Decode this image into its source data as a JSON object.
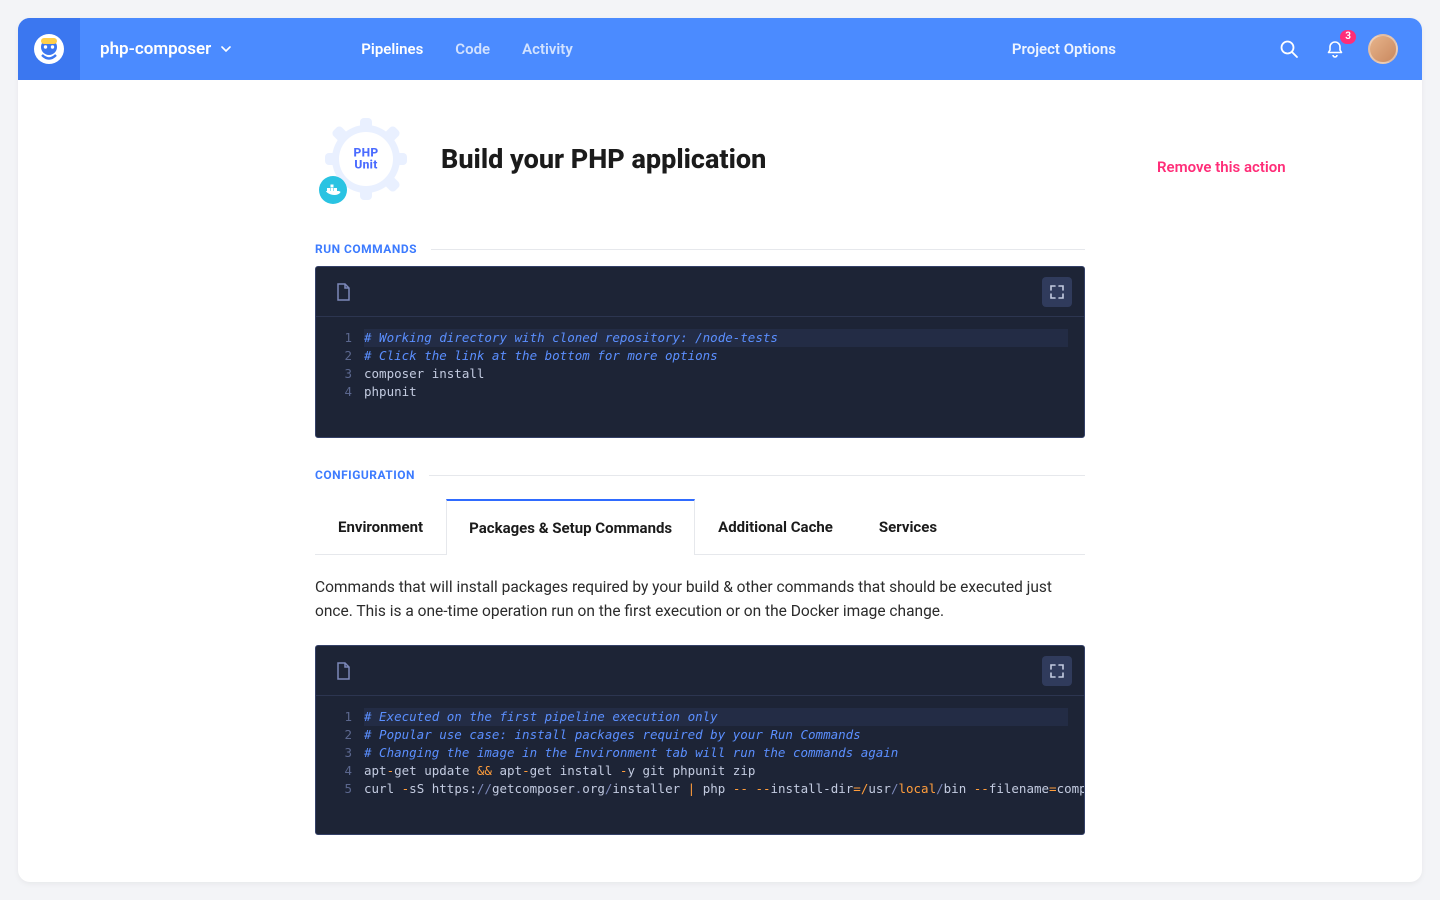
{
  "header": {
    "project_name": "php-composer",
    "nav": {
      "pipelines": "Pipelines",
      "code": "Code",
      "activity": "Activity"
    },
    "project_options": "Project Options",
    "notifications_count": "3"
  },
  "page": {
    "title": "Build your PHP application",
    "logo": {
      "line1": "PHP",
      "line2": "Unit"
    }
  },
  "side": {
    "remove": "Remove this action"
  },
  "sections": {
    "run_commands_label": "RUN COMMANDS",
    "configuration_label": "CONFIGURATION"
  },
  "tabs": {
    "environment": "Environment",
    "packages": "Packages & Setup Commands",
    "cache": "Additional Cache",
    "services": "Services"
  },
  "tab_desc": "Commands that will install packages required by your build & other commands that should be executed just once. This is a one-time operation run on the first execution or on the Docker image change.",
  "editor1": {
    "lines": [
      {
        "n": "1",
        "type": "comment",
        "text": "# Working directory with cloned repository: /node-tests"
      },
      {
        "n": "2",
        "type": "comment",
        "text": "# Click the link at the bottom for more options"
      },
      {
        "n": "3",
        "type": "plain",
        "text": "composer install"
      },
      {
        "n": "4",
        "type": "plain",
        "text": "phpunit"
      }
    ]
  },
  "editor2": {
    "lines": [
      {
        "n": "1",
        "type": "comment",
        "text": "# Executed on the first pipeline execution only"
      },
      {
        "n": "2",
        "type": "comment",
        "text": "# Popular use case: install packages required by your Run Commands"
      },
      {
        "n": "3",
        "type": "comment",
        "text": "# Changing the image in the Environment tab will run the commands again"
      },
      {
        "n": "4",
        "type": "apt"
      },
      {
        "n": "5",
        "type": "curl"
      }
    ],
    "apt": {
      "pre": "apt",
      "dash1": "-",
      "get_update": "get update ",
      "amp": "&&",
      "sp": " apt",
      "dash2": "-",
      "tail": "get install ",
      "flag_dash": "-",
      "flagval": "y git phpunit zip"
    },
    "curl": {
      "pre": "curl ",
      "dash1": "-",
      "sS": "sS https:",
      "sl": "//",
      "host": "getcomposer",
      "dot": ".",
      "org": "org",
      "sl2": "/",
      "inst": "installer ",
      "pipe": "|",
      "php": " php ",
      "dd1": "--",
      "sp1": " ",
      "dd2": "--",
      "install_dir": "install-dir",
      "eq1": "=/",
      "usr": "usr",
      "sl3": "/",
      "local": "local",
      "sl4": "/",
      "bin": "bin ",
      "dd3": "--",
      "filename": "filename",
      "eq2": "=",
      "comp": "comp"
    }
  }
}
